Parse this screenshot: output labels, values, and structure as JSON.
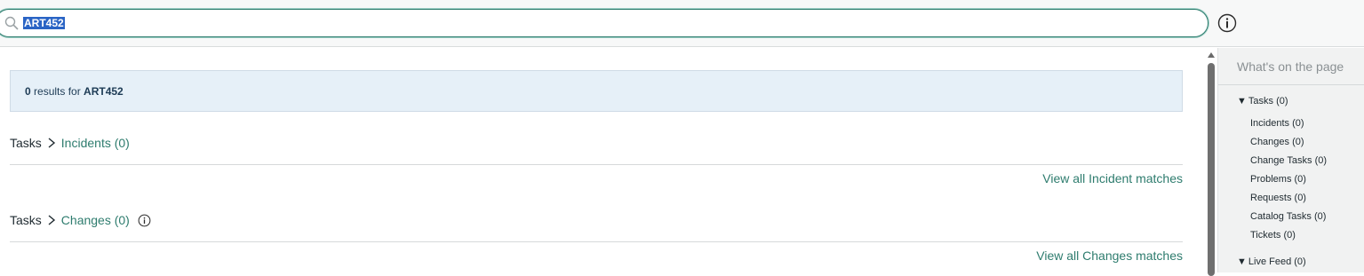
{
  "search": {
    "value": "ART452"
  },
  "banner": {
    "count": "0",
    "mid_text": " results for ",
    "query": "ART452"
  },
  "sections": [
    {
      "parent": "Tasks",
      "name": "Incidents (0)",
      "view_all": "View all Incident matches"
    },
    {
      "parent": "Tasks",
      "name": "Changes (0)",
      "view_all": "View all Changes matches"
    }
  ],
  "side_panel": {
    "title": "What's on the page",
    "groups": [
      {
        "label": "Tasks (0)",
        "items": [
          "Incidents (0)",
          "Changes (0)",
          "Change Tasks (0)",
          "Problems (0)",
          "Requests (0)",
          "Catalog Tasks (0)",
          "Tickets (0)"
        ]
      },
      {
        "label": "Live Feed (0)",
        "items": []
      }
    ]
  },
  "colors": {
    "accent": "#2e7c6e",
    "banner_bg": "#e6f0f8",
    "selection": "#2a64c5"
  }
}
